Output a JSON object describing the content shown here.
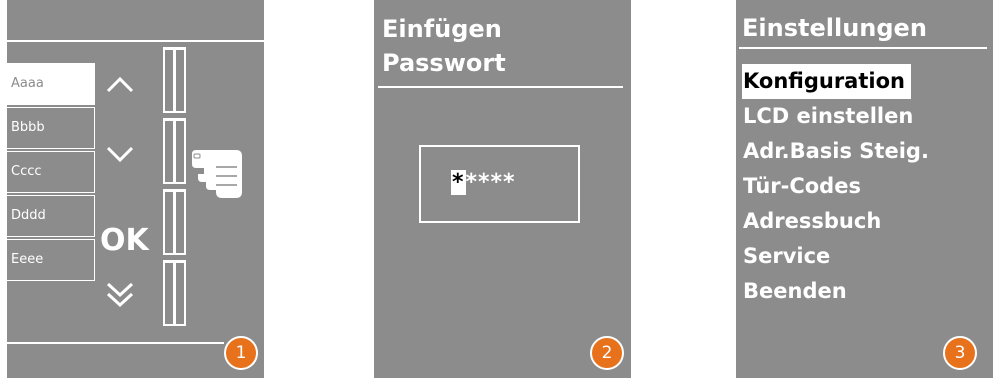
{
  "colors": {
    "panel": "#8c8c8c",
    "badge": "#e8711c",
    "text": "#ffffff"
  },
  "panel1": {
    "labels": [
      "Aaaa",
      "Bbbb",
      "Cccc",
      "Dddd",
      "Eeee"
    ],
    "ok_label": "OK",
    "icons": [
      "chevron-up-icon",
      "chevron-down-icon",
      "double-chevron-down-icon",
      "pointing-hand-icon"
    ],
    "badge": "1"
  },
  "panel2": {
    "title_line1": "Einfügen",
    "title_line2": "Passwort",
    "pw_cursor": "*",
    "pw_rest": "****",
    "badge": "2"
  },
  "panel3": {
    "title": "Einstellungen",
    "menu": [
      "Konfiguration",
      "LCD einstellen",
      "Adr.Basis Steig.",
      "Tür-Codes",
      "Adressbuch",
      "Service",
      "Beenden"
    ],
    "badge": "3"
  }
}
